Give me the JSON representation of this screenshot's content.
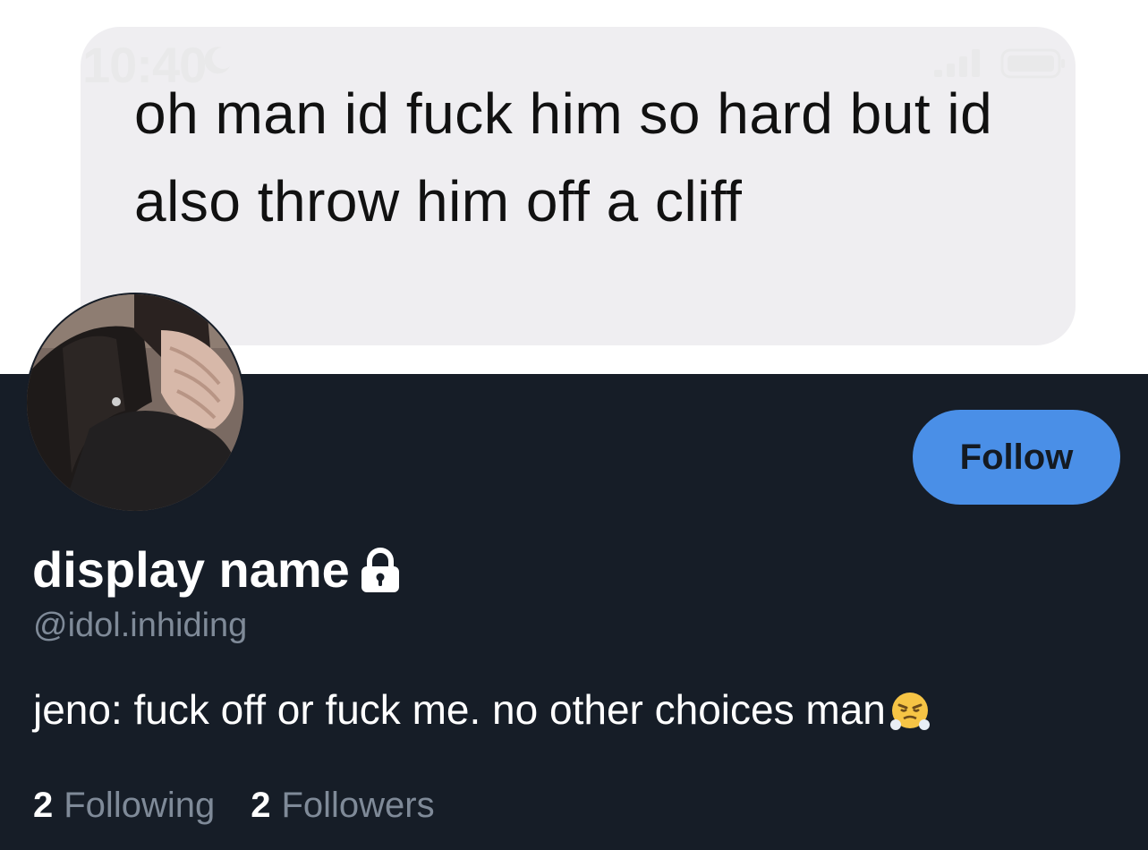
{
  "banner": {
    "status_time": "10:40",
    "message_text": "oh man id fuck him so hard but id also throw him off a cliff"
  },
  "profile": {
    "follow_label": "Follow",
    "display_name": "display name",
    "handle": "@idol.inhiding",
    "bio": "jeno: fuck off or fuck me. no other choices man",
    "following_count": "2",
    "following_label": "Following",
    "followers_count": "2",
    "followers_label": "Followers"
  },
  "colors": {
    "background": "#161d27",
    "accent": "#4a8fe7",
    "muted_text": "#7f8a98"
  },
  "icons": [
    "moon-icon",
    "signal-icon",
    "battery-icon",
    "lock-icon",
    "steam-face-emoji-icon"
  ]
}
